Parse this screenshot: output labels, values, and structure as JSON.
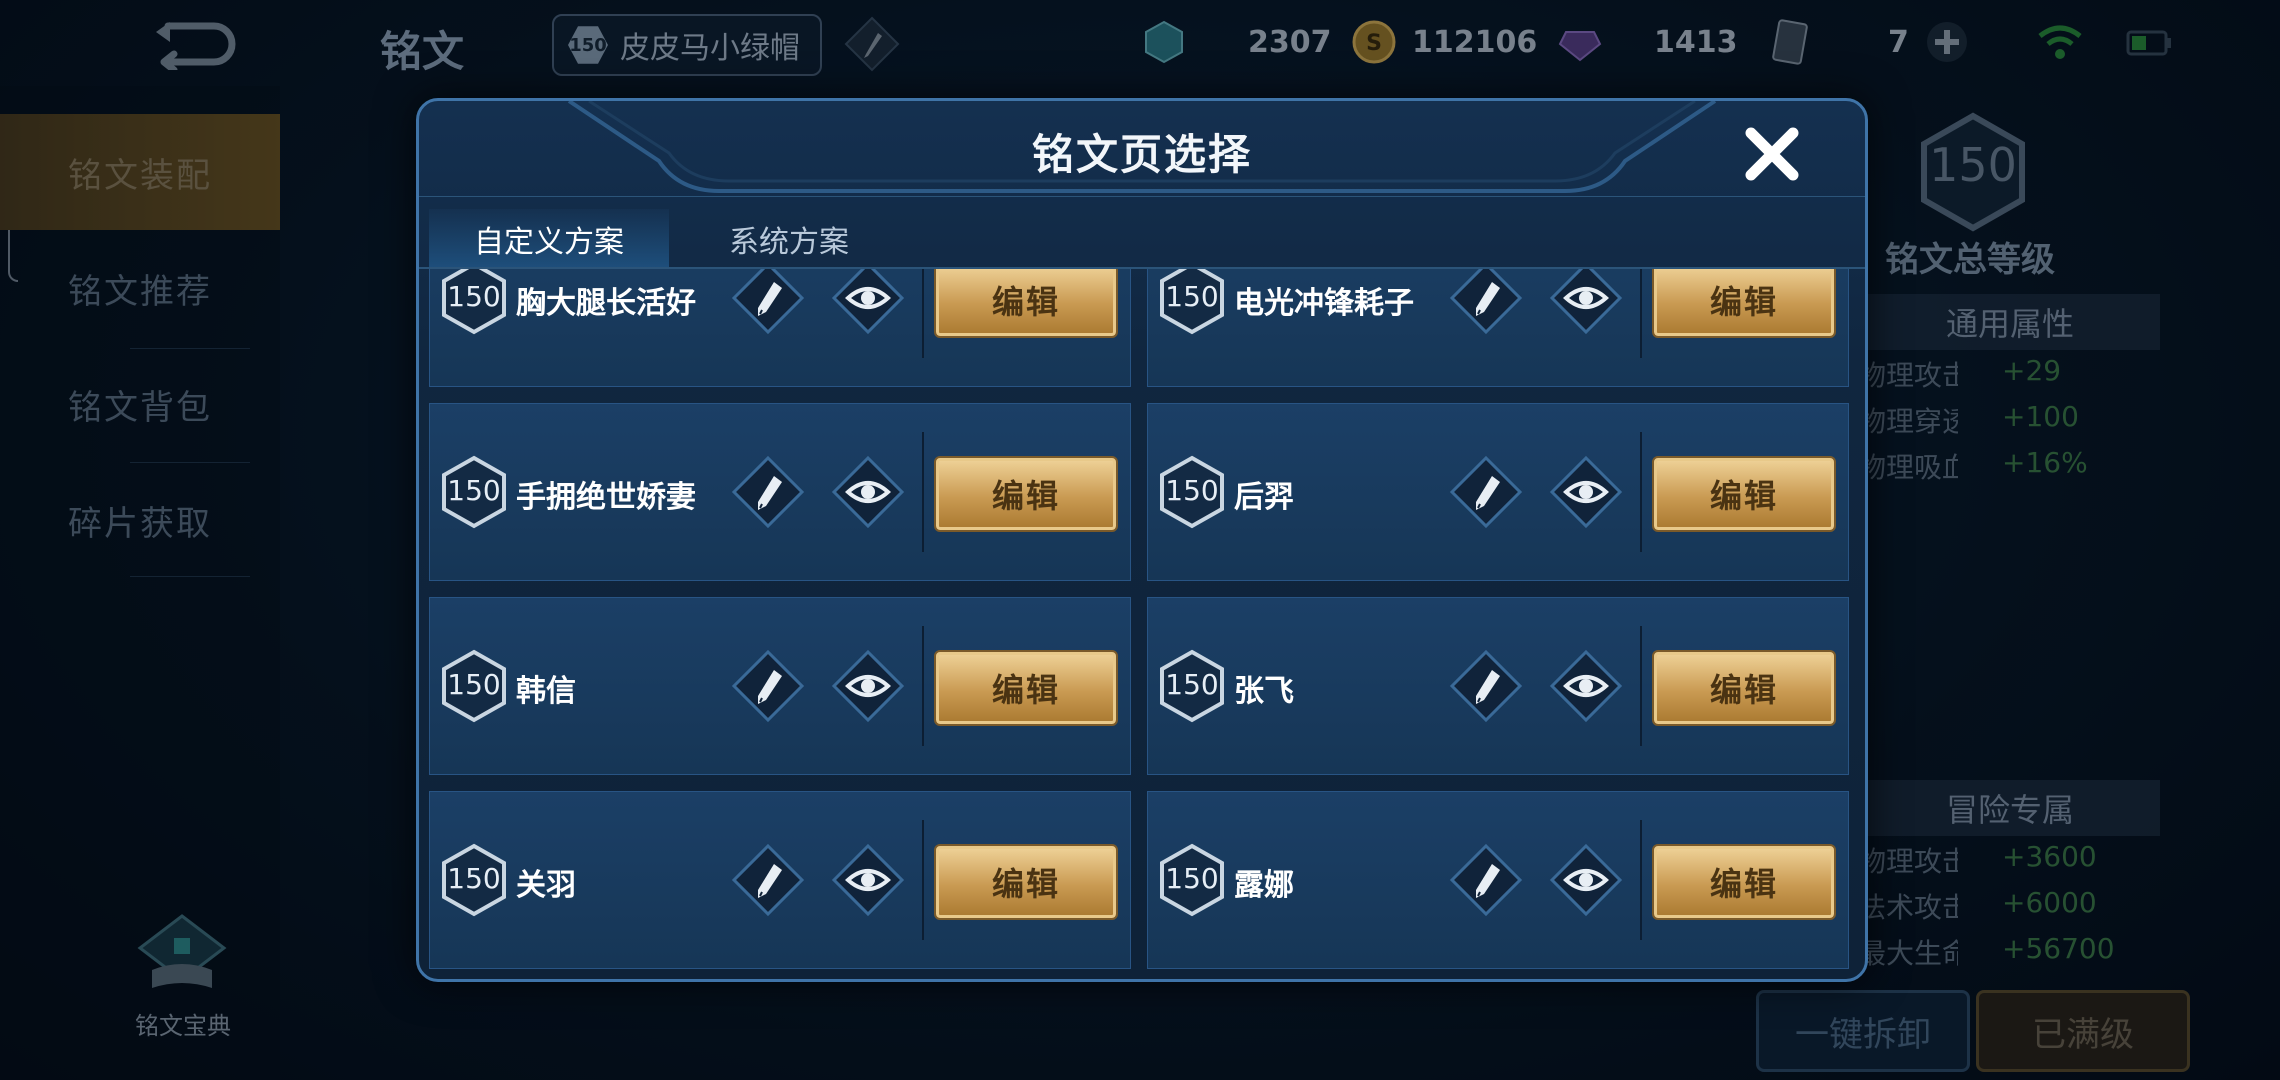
{
  "topbar": {
    "title": "铭文",
    "rank": {
      "level": "150",
      "name": "皮皮马小绿帽"
    },
    "currencies": [
      {
        "icon": "crystal-icon",
        "value": "2307"
      },
      {
        "icon": "gold-coin-icon",
        "value": "112106"
      },
      {
        "icon": "gem-icon",
        "value": "1413"
      },
      {
        "icon": "card-icon",
        "value": "7"
      }
    ]
  },
  "sidebar": {
    "items": [
      {
        "label": "铭文装配",
        "active": true
      },
      {
        "label": "铭文推荐"
      },
      {
        "label": "铭文背包"
      },
      {
        "label": "碎片获取"
      }
    ],
    "codex_label": "铭文宝典"
  },
  "right_panel": {
    "total_level": "150",
    "total_level_label": "铭文总等级",
    "general_header": "通用属性",
    "general_attrs": [
      {
        "name": "物理攻击",
        "value": "+29"
      },
      {
        "name": "物理穿透",
        "value": "+100"
      },
      {
        "name": "物理吸血",
        "value": "+16%"
      }
    ],
    "adventure_header": "冒险专属",
    "adventure_attrs": [
      {
        "name": "物理攻击",
        "value": "+3600"
      },
      {
        "name": "法术攻击",
        "value": "+6000"
      },
      {
        "name": "最大生命",
        "value": "+56700"
      }
    ],
    "uninstall_label": "一键拆卸",
    "maxed_label": "已满级"
  },
  "modal": {
    "title": "铭文页选择",
    "tabs": [
      {
        "label": "自定义方案",
        "active": true
      },
      {
        "label": "系统方案"
      }
    ],
    "edit_label": "编辑",
    "pages": [
      {
        "level": "150",
        "name": "胸大腿长活好"
      },
      {
        "level": "150",
        "name": "电光冲锋耗子"
      },
      {
        "level": "150",
        "name": "手拥绝世娇妻"
      },
      {
        "level": "150",
        "name": "后羿"
      },
      {
        "level": "150",
        "name": "韩信"
      },
      {
        "level": "150",
        "name": "张飞"
      },
      {
        "level": "150",
        "name": "关羽"
      },
      {
        "level": "150",
        "name": "露娜"
      }
    ]
  }
}
